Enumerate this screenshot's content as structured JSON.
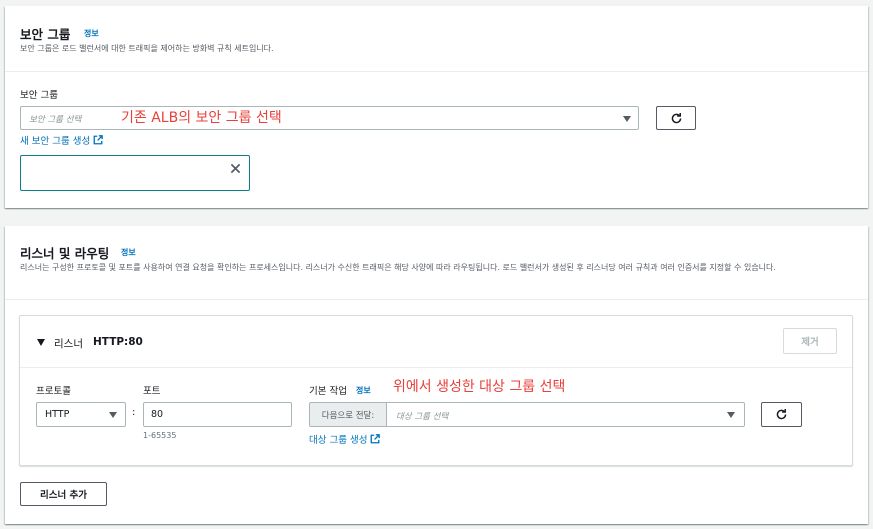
{
  "security_groups_section": {
    "title": "보안 그룹",
    "info_label": "정보",
    "description": "보안 그룹은 로드 밸런서에 대한 트래픽을 제어하는 방화벽 규칙 세트입니다.",
    "field_label": "보안 그룹",
    "select_placeholder": "보안 그룹 선택",
    "annotation": "기존 ALB의 보안 그룹 선택",
    "create_link": "새 보안 그룹 생성"
  },
  "listeners_section": {
    "title": "리스너 및 라우팅",
    "info_label": "정보",
    "description": "리스너는 구성한 프로토콜 및 포트를 사용하여 연결 요청을 확인하는 프로세스입니다. 리스너가 수신한 트래픽은 해당 사양에 따라 라우팅됩니다. 로드 밸런서가 생성된 후 리스너당 여러 규칙과 여러 인증서를 지정할 수 있습니다.",
    "listener": {
      "label": "리스너",
      "name": "HTTP:80",
      "remove_button": "제거",
      "protocol_label": "프로토콜",
      "protocol_value": "HTTP",
      "port_label": "포트",
      "port_value": "80",
      "port_separator": ":",
      "port_hint": "1-65535",
      "default_action_label": "기본 작업",
      "default_action_info": "정보",
      "annotation": "위에서 생성한 대상 그룹 선택",
      "forward_prefix": "다음으로 전달:",
      "target_group_placeholder": "대상 그룹 선택",
      "create_target_group_link": "대상 그룹 생성"
    },
    "add_listener_button": "리스너 추가"
  },
  "colors": {
    "link": "#0073bb",
    "annotation": "#e8403a",
    "token_border": "#0d7d8a"
  }
}
